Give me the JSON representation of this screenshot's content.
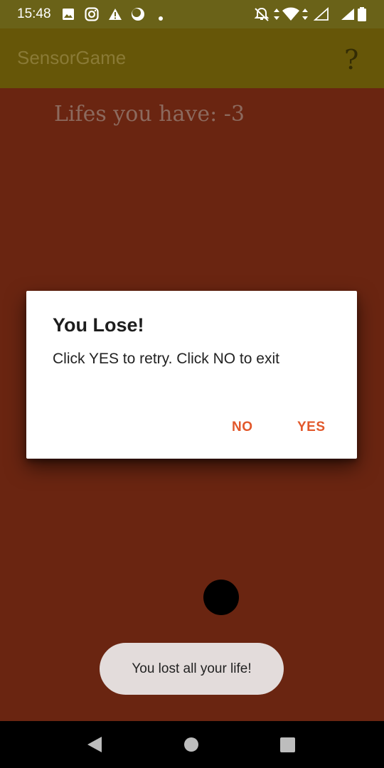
{
  "status_bar": {
    "time": "15:48",
    "icons_left": [
      "image-icon",
      "instagram-icon",
      "warning-icon",
      "moon-icon",
      "dot-icon"
    ],
    "icons_right": [
      "notifications-off-icon",
      "data-arrows-icon",
      "wifi-icon",
      "signal-empty-icon",
      "signal-full-icon",
      "battery-icon"
    ]
  },
  "app_bar": {
    "title": "SensorGame",
    "help_label": "?"
  },
  "main": {
    "lives_text": "Lifes you have: -3"
  },
  "dialog": {
    "title": "You Lose!",
    "message": "Click YES to retry. Click NO to exit",
    "no_label": "NO",
    "yes_label": "YES"
  },
  "toast": {
    "text": "You lost all your life!"
  },
  "nav_bar": {
    "icons": [
      "back-icon",
      "home-icon",
      "recents-icon"
    ]
  },
  "colors": {
    "background": "#6a2511",
    "status_bar": "#6a6218",
    "app_bar": "#665608",
    "dialog_button": "#e2582b",
    "toast": "#e3dcdb"
  }
}
